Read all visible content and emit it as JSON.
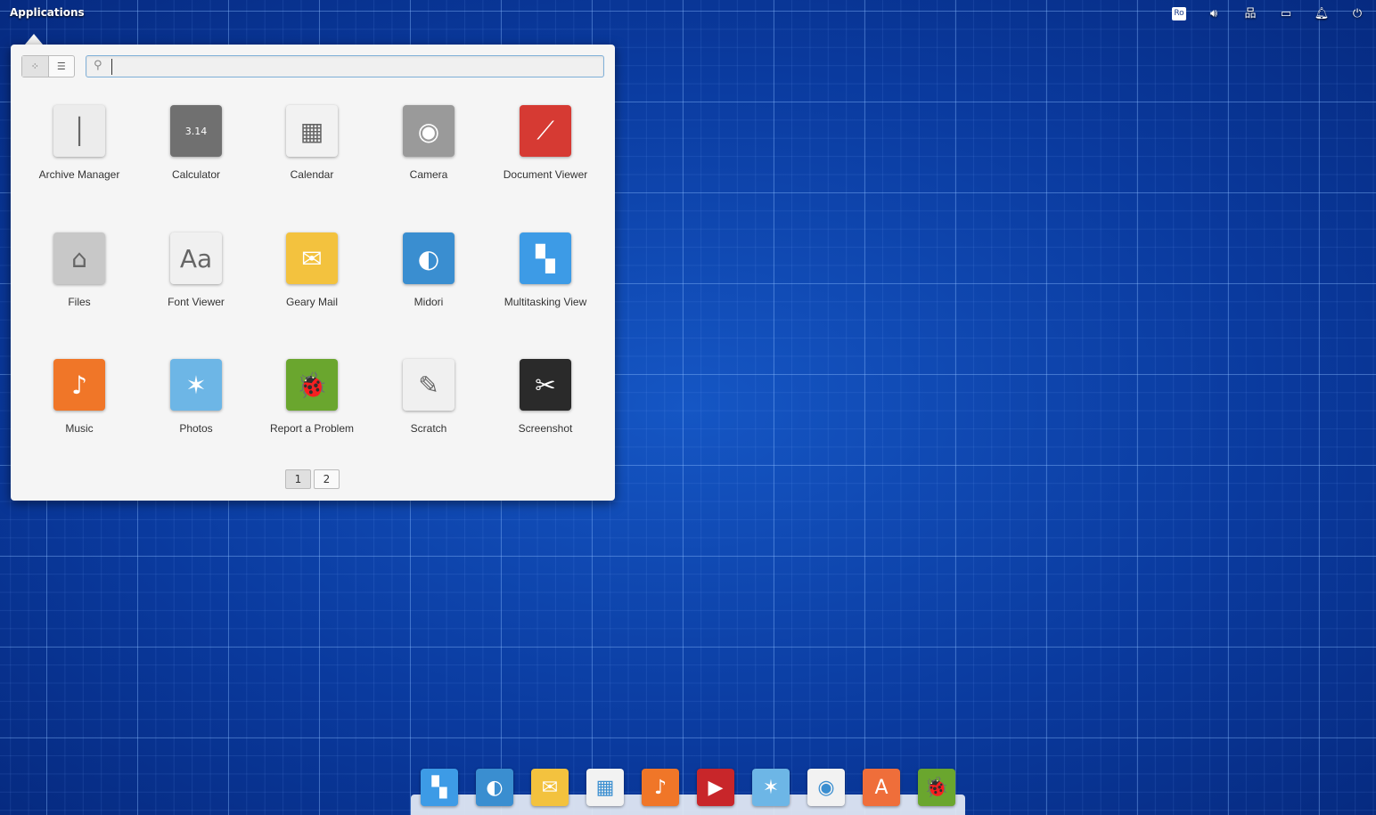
{
  "panel": {
    "applications": "Applications",
    "keyboard": "Ro",
    "indicators": [
      "keyboard-layout",
      "volume-icon",
      "network-icon",
      "battery-icon",
      "notifications-icon",
      "power-icon"
    ]
  },
  "launcher": {
    "search_placeholder": "",
    "view_modes": [
      "grid-view",
      "category-view"
    ],
    "apps": [
      {
        "label": "Archive Manager",
        "icon": "archive-icon",
        "color": "#ececec",
        "glyph": "│"
      },
      {
        "label": "Calculator",
        "icon": "calculator-icon",
        "color": "#707070",
        "glyph": "3.14"
      },
      {
        "label": "Calendar",
        "icon": "calendar-icon",
        "color": "#f2f2f2",
        "glyph": "▦"
      },
      {
        "label": "Camera",
        "icon": "camera-icon",
        "color": "#9a9a9a",
        "glyph": "◉"
      },
      {
        "label": "Document Viewer",
        "icon": "document-viewer-icon",
        "color": "#d63a33",
        "glyph": "⟋"
      },
      {
        "label": "Files",
        "icon": "folder-icon",
        "color": "#c8c8c8",
        "glyph": "⌂"
      },
      {
        "label": "Font Viewer",
        "icon": "font-viewer-icon",
        "color": "#f0f0f0",
        "glyph": "Aa"
      },
      {
        "label": "Geary Mail",
        "icon": "mail-icon",
        "color": "#f3c23e",
        "glyph": "✉"
      },
      {
        "label": "Midori",
        "icon": "browser-icon",
        "color": "#3a8ed0",
        "glyph": "◐"
      },
      {
        "label": "Multitasking View",
        "icon": "multitasking-icon",
        "color": "#3d9be6",
        "glyph": "▚"
      },
      {
        "label": "Music",
        "icon": "music-icon",
        "color": "#f07628",
        "glyph": "♪"
      },
      {
        "label": "Photos",
        "icon": "photos-icon",
        "color": "#6db6e6",
        "glyph": "✶"
      },
      {
        "label": "Report a Problem",
        "icon": "bug-icon",
        "color": "#6aa62e",
        "glyph": "🐞"
      },
      {
        "label": "Scratch",
        "icon": "text-editor-icon",
        "color": "#f0f0f0",
        "glyph": "✎"
      },
      {
        "label": "Screenshot",
        "icon": "screenshot-icon",
        "color": "#2a2a2a",
        "glyph": "✂"
      }
    ],
    "pages": [
      "1",
      "2"
    ],
    "current_page": "1"
  },
  "dock": [
    {
      "name": "multitasking-view",
      "icon": "multitasking-icon",
      "color": "#3d9be6",
      "glyph": "▚"
    },
    {
      "name": "midori",
      "icon": "browser-icon",
      "color": "#3a8ed0",
      "glyph": "◐"
    },
    {
      "name": "geary-mail",
      "icon": "mail-icon",
      "color": "#f3c23e",
      "glyph": "✉"
    },
    {
      "name": "calendar",
      "icon": "calendar-icon",
      "color": "#f2f2f2",
      "glyph": "▦"
    },
    {
      "name": "music",
      "icon": "music-icon",
      "color": "#f07628",
      "glyph": "♪"
    },
    {
      "name": "videos",
      "icon": "video-icon",
      "color": "#c8262a",
      "glyph": "▶"
    },
    {
      "name": "photos",
      "icon": "photos-icon",
      "color": "#6db6e6",
      "glyph": "✶"
    },
    {
      "name": "system-settings",
      "icon": "settings-toggle-icon",
      "color": "#f2f2f2",
      "glyph": "◉"
    },
    {
      "name": "app-center",
      "icon": "app-store-icon",
      "color": "#ef6e3a",
      "glyph": "A"
    },
    {
      "name": "report-a-problem",
      "icon": "bug-icon",
      "color": "#6aa62e",
      "glyph": "🐞"
    }
  ]
}
